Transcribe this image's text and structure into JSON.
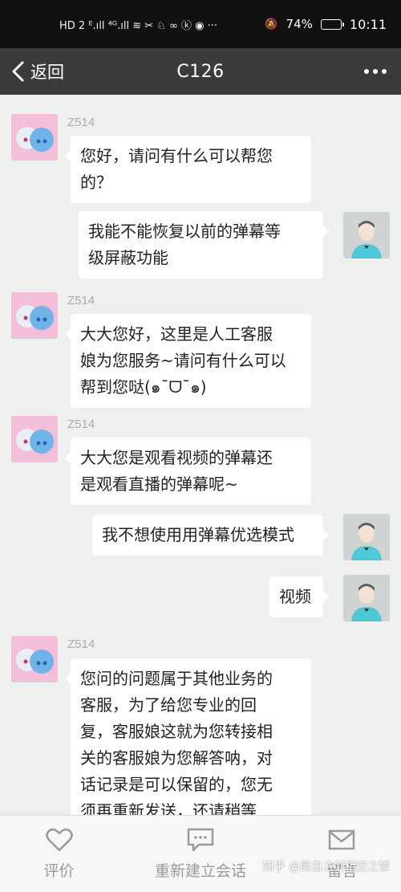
{
  "status_bar": {
    "left_icons": "HD 2  ᴱ.ıll ⁴ᴳ.ıll ≋ ✂ ♘ ∞ ⓚ ◉ ···",
    "battery_percent": "74%",
    "battery_level": 0.74,
    "time": "10:11"
  },
  "titlebar": {
    "back_label": "返回",
    "title": "C126"
  },
  "messages": [
    {
      "side": "left",
      "sender": "Z514",
      "lines": [
        "您好，请问有什么可以帮您",
        "的？"
      ]
    },
    {
      "side": "right",
      "lines": [
        "我能不能恢复以前的弹幕等",
        "级屏蔽功能"
      ]
    },
    {
      "side": "left",
      "sender": "Z514",
      "lines": [
        "大大您好，这里是人工客服",
        "娘为您服务~请问有什么可以",
        "帮到您哒(๑¯ᗜ¯๑)"
      ]
    },
    {
      "side": "left",
      "sender": "Z514",
      "lines": [
        "大大您是观看视频的弹幕还",
        "是观看直播的弹幕呢~"
      ]
    },
    {
      "side": "right",
      "lines": [
        "我不想使用用弹幕优选模式"
      ]
    },
    {
      "side": "right",
      "lines": [
        "视频"
      ]
    },
    {
      "side": "left",
      "sender": "Z514",
      "lines": [
        "您问的问题属于其他业务的",
        "客服，为了给您专业的回",
        "复，客服娘这就为您转接相",
        "关的客服娘为您解答呐，对",
        "话记录是可以保留的，您无",
        "须再重新发送，还请稍等"
      ]
    }
  ],
  "bottom_bar": {
    "rate_label": "评价",
    "restart_label": "重新建立会话",
    "leave_message_label": "留言"
  },
  "watermark": "知乎 @黑白之剑相交之誓",
  "colors": {
    "status_bar_bg": "#111111",
    "title_bar_bg": "#3b3b3b",
    "chat_bg": "#eef0ee",
    "bubble_bg": "#ffffff",
    "bottom_bar_bg": "#f7f7f7"
  }
}
